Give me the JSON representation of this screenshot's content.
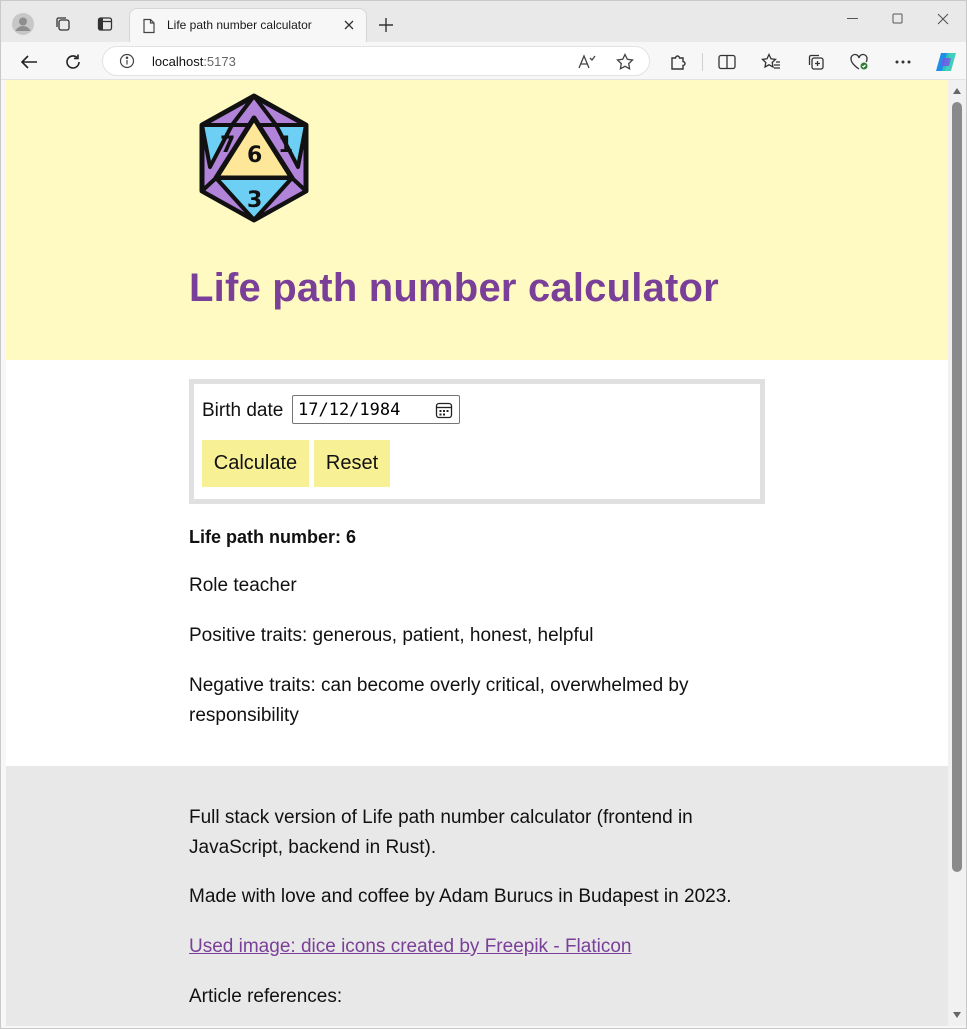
{
  "browser": {
    "tab_title": "Life path number calculator",
    "url_host": "localhost",
    "url_port": ":5173"
  },
  "page": {
    "logo_numbers": [
      "7",
      "6",
      "1",
      "3"
    ],
    "title": "Life path number calculator",
    "form": {
      "birth_date_label": "Birth date",
      "birth_date_value": "17/12/1984",
      "calculate_label": "Calculate",
      "reset_label": "Reset"
    },
    "result": {
      "heading": "Life path number: 6",
      "role": "Role teacher",
      "positive": "Positive traits: generous, patient, honest, helpful",
      "negative": "Negative traits: can become overly critical, overwhelmed by responsibility"
    },
    "footer": {
      "fullstack": "Full stack version of Life path number calculator (frontend in JavaScript, backend in Rust).",
      "made_with": "Made with love and coffee by Adam Burucs in Budapest in 2023.",
      "image_credit": "Used image: dice icons created by Freepik - Flaticon",
      "references": "Article references:"
    }
  },
  "colors": {
    "hero_bg": "#fffac2",
    "title": "#7a3f98",
    "button_bg": "#f7f094",
    "footer_bg": "#e8e8e8"
  }
}
